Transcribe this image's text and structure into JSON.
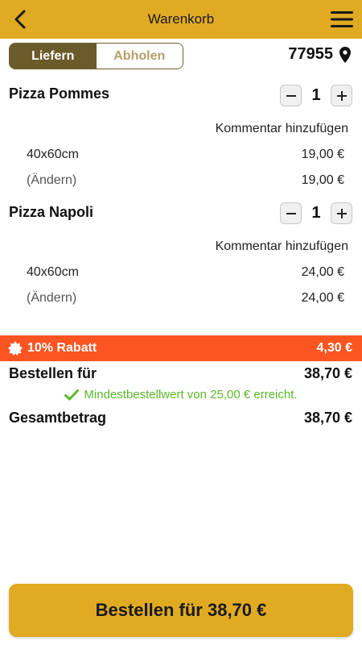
{
  "header": {
    "title": "Warenkorb"
  },
  "delivery_toggle": {
    "deliver_label": "Liefern",
    "pickup_label": "Abholen"
  },
  "location": {
    "zip": "77955"
  },
  "items": [
    {
      "name": "Pizza Pommes",
      "quantity": "1",
      "comment_label": "Kommentar hinzufügen",
      "size_label": "40x60cm",
      "size_price": "19,00 €",
      "change_label": "(Ändern)",
      "total_price": "19,00 €"
    },
    {
      "name": "Pizza Napoli",
      "quantity": "1",
      "comment_label": "Kommentar hinzufügen",
      "size_label": "40x60cm",
      "size_price": "24,00 €",
      "change_label": "(Ändern)",
      "total_price": "24,00 €"
    }
  ],
  "discount": {
    "label": "10% Rabatt",
    "amount": "4,30 €"
  },
  "summary": {
    "order_for_label": "Bestellen für",
    "order_for_value": "38,70 €",
    "minimum_text": "Mindestbestellwert von 25,00 € erreicht.",
    "total_label": "Gesamtbetrag",
    "total_value": "38,70 €"
  },
  "order_button": {
    "label": "Bestellen für 38,70 €"
  },
  "colors": {
    "accent": "#e0aa22",
    "toggle_active": "#6b5a2a",
    "discount": "#fb5522",
    "success": "#5cb82a"
  }
}
